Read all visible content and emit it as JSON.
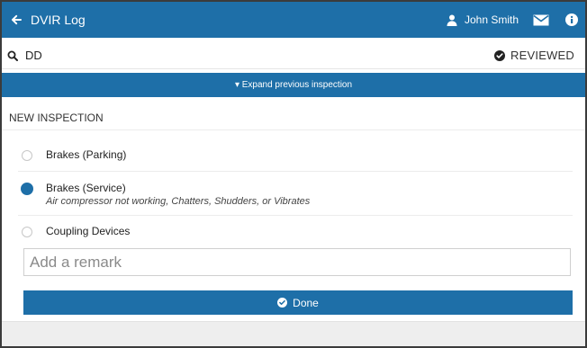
{
  "app": {
    "title": "DVIR Log"
  },
  "header": {
    "user_name": "John Smith",
    "icons": [
      "back-arrow-icon",
      "user-icon",
      "mail-icon",
      "info-icon"
    ]
  },
  "search": {
    "term": "DD",
    "status": "REVIEWED"
  },
  "expand": {
    "label": "▾ Expand previous inspection"
  },
  "inspection": {
    "heading": "NEW INSPECTION",
    "items": [
      {
        "label": "Brakes (Parking)",
        "detail": "",
        "selected": false
      },
      {
        "label": "Brakes (Service)",
        "detail": "Air compressor not working, Chatters, Shudders, or Vibrates",
        "selected": true
      },
      {
        "label": "Coupling Devices",
        "detail": "",
        "selected": false
      }
    ]
  },
  "remark": {
    "placeholder": "Add a remark",
    "value": ""
  },
  "done": {
    "label": "Done"
  },
  "colors": {
    "primary": "#1e6fa8",
    "border": "#3b3b3b"
  }
}
